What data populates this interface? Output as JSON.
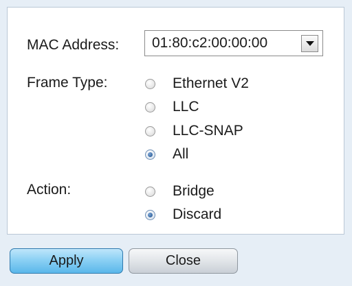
{
  "form": {
    "mac_label": "MAC Address:",
    "mac_value": "01:80:c2:00:00:00",
    "frame_type_label": "Frame Type:",
    "frame_types": [
      {
        "label": "Ethernet V2",
        "checked": false
      },
      {
        "label": "LLC",
        "checked": false
      },
      {
        "label": "LLC-SNAP",
        "checked": false
      },
      {
        "label": "All",
        "checked": true
      }
    ],
    "action_label": "Action:",
    "actions": [
      {
        "label": "Bridge",
        "checked": false
      },
      {
        "label": "Discard",
        "checked": true
      }
    ]
  },
  "buttons": {
    "apply_label": "Apply",
    "close_label": "Close"
  }
}
